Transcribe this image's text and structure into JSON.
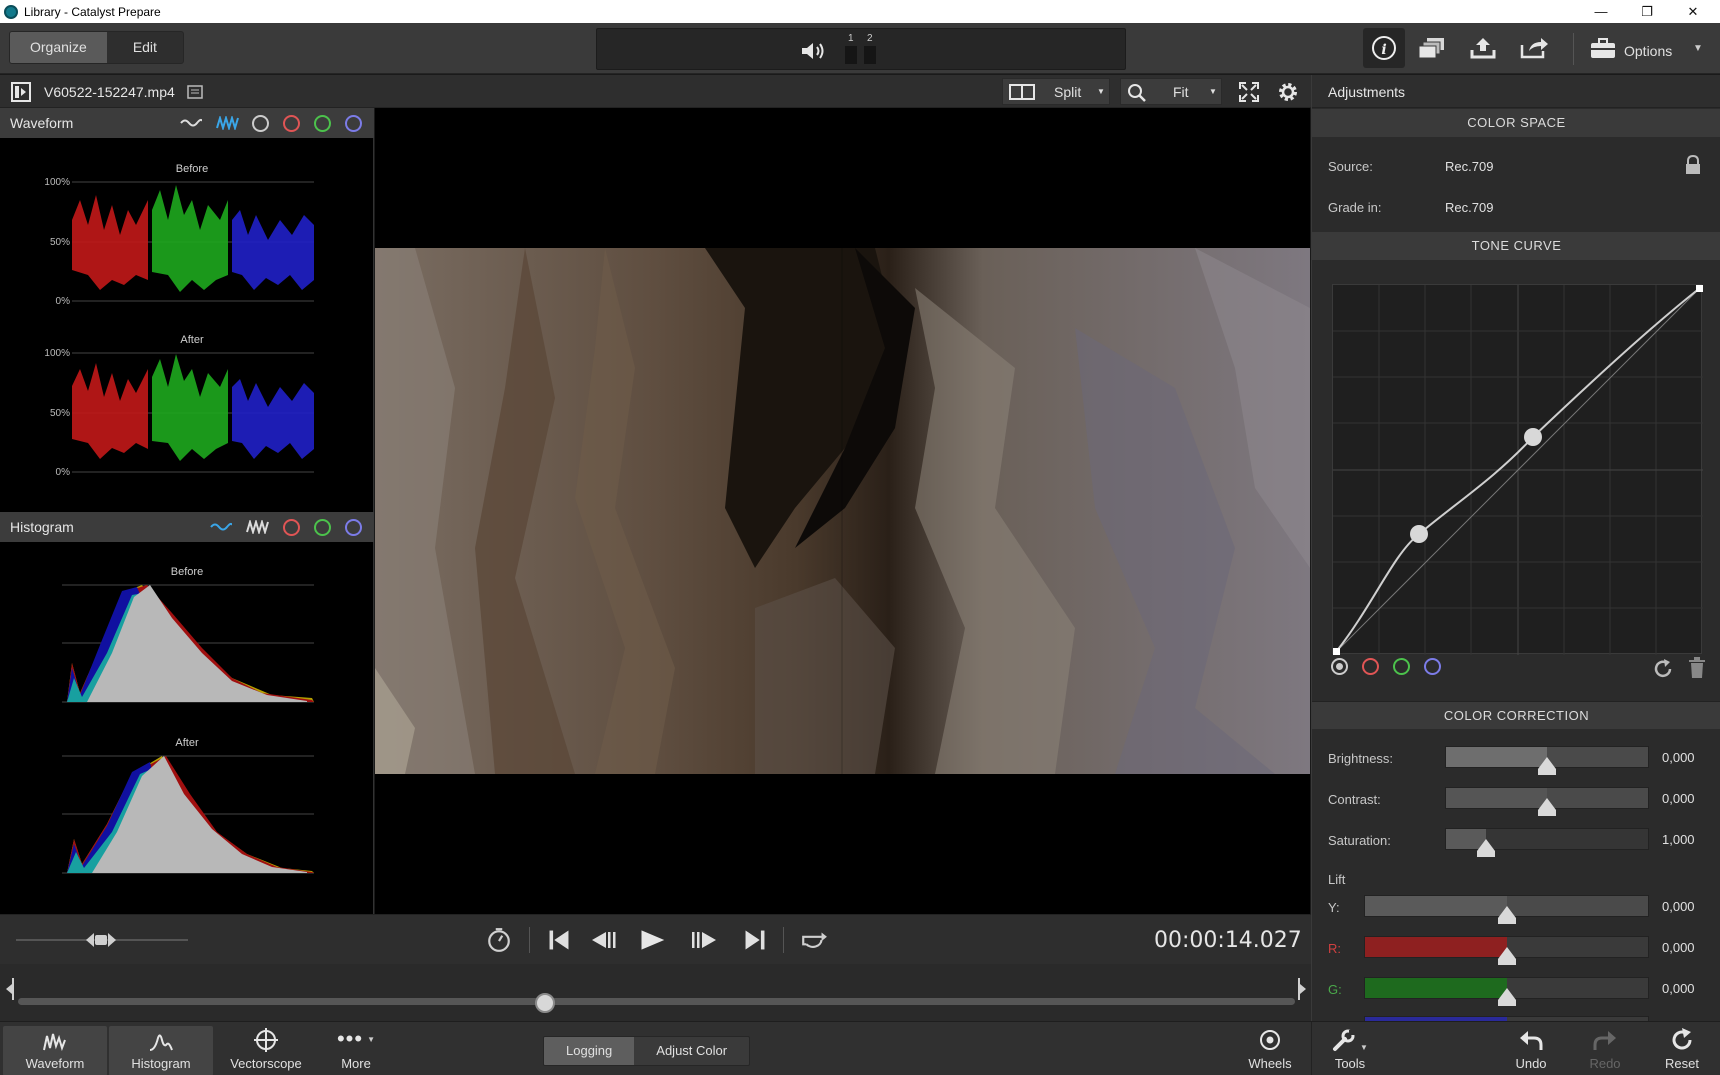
{
  "window": {
    "title": "Library - Catalyst Prepare"
  },
  "toolbar": {
    "organize_label": "Organize",
    "edit_label": "Edit",
    "audio_channels": [
      "1",
      "2"
    ],
    "options_label": "Options"
  },
  "clip": {
    "filename": "V60522-152247.mp4",
    "split_label": "Split",
    "zoom_label": "Fit"
  },
  "waveform": {
    "title": "Waveform",
    "before_label": "Before",
    "after_label": "After",
    "axis": [
      "100%",
      "50%",
      "0%"
    ]
  },
  "histogram": {
    "title": "Histogram",
    "before_label": "Before",
    "after_label": "After"
  },
  "adjustments": {
    "title": "Adjustments",
    "color_space": {
      "title": "COLOR SPACE",
      "source_label": "Source:",
      "source_value": "Rec.709",
      "grade_label": "Grade in:",
      "grade_value": "Rec.709"
    },
    "tone_curve": {
      "title": "TONE CURVE"
    },
    "color_correction": {
      "title": "COLOR CORRECTION",
      "brightness_label": "Brightness:",
      "brightness_value": "0,000",
      "brightness_level": 0.5,
      "contrast_label": "Contrast:",
      "contrast_value": "0,000",
      "contrast_level": 0.5,
      "saturation_label": "Saturation:",
      "saturation_value": "1,000",
      "saturation_level": 0.2
    },
    "lift": {
      "title": "Lift",
      "y_label": "Y:",
      "y_value": "0,000",
      "r_label": "R:",
      "r_value": "0,000",
      "g_label": "G:",
      "g_value": "0,000"
    }
  },
  "transport": {
    "timecode": "00:00:14.027"
  },
  "bottom": {
    "waveform_label": "Waveform",
    "histogram_label": "Histogram",
    "vectorscope_label": "Vectorscope",
    "more_label": "More",
    "logging_label": "Logging",
    "adjust_color_label": "Adjust Color",
    "wheels_label": "Wheels",
    "tools_label": "Tools",
    "undo_label": "Undo",
    "redo_label": "Redo",
    "reset_label": "Reset"
  }
}
